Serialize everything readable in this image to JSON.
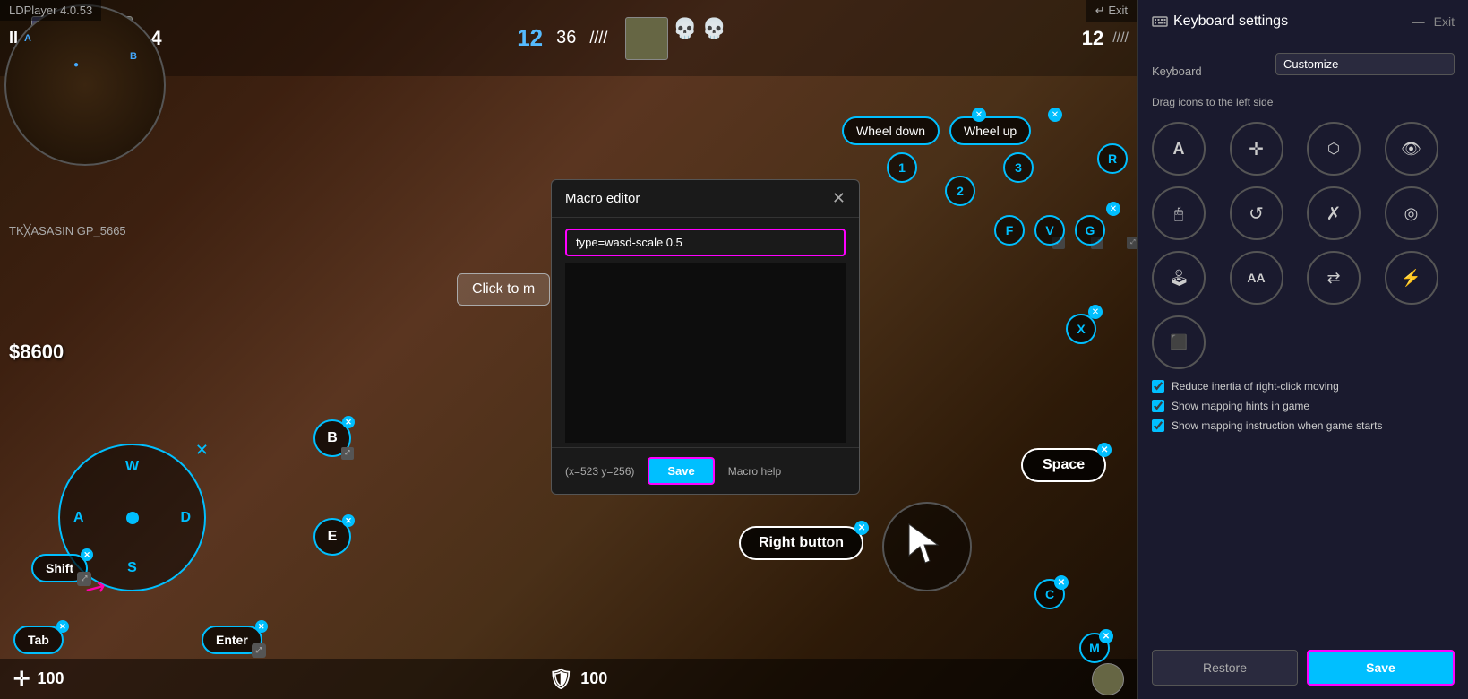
{
  "app": {
    "title": "LDPlayer 4.0.53",
    "exit_label": "Exit",
    "minimize_label": "—"
  },
  "panel": {
    "title": "Keyboard settings",
    "keyboard_label": "Keyboard",
    "keyboard_option": "Customize",
    "drag_hint": "Drag icons to the left side",
    "restore_label": "Restore",
    "save_label": "Save"
  },
  "checkboxes": [
    {
      "id": "cb1",
      "label": "Reduce inertia of right-click moving",
      "checked": true
    },
    {
      "id": "cb2",
      "label": "Show mapping hints in game",
      "checked": true
    },
    {
      "id": "cb3",
      "label": "Show mapping instruction when game starts",
      "checked": true
    }
  ],
  "hud": {
    "pause": "II",
    "left_score": "4",
    "right_score": "12",
    "time": "36",
    "ammo_main": "100",
    "ammo_reserve": "100",
    "money": "$8600",
    "player_name": "TK╳ASASIN       GP_5665"
  },
  "wasd": {
    "w": "W",
    "a": "A",
    "s": "S",
    "d": "D"
  },
  "buttons": {
    "shift": "Shift",
    "tab": "Tab",
    "enter": "Enter",
    "b": "B",
    "e": "E",
    "f": "F",
    "v": "V",
    "g": "G",
    "r": "R",
    "x": "X",
    "c": "C",
    "m": "M",
    "space": "Space",
    "right_button": "Right button",
    "wheel_down": "Wheel down",
    "wheel_up": "Wheel up",
    "num1": "1",
    "num2": "2",
    "num3": "3"
  },
  "macro": {
    "title": "Macro editor",
    "input_value": "type=wasd-scale 0.5",
    "textarea_value": "",
    "coords": "(x=523  y=256)",
    "save_label": "Save",
    "help_label": "Macro help"
  },
  "click_to": "Click to m",
  "icons": [
    {
      "name": "A-icon",
      "symbol": "A"
    },
    {
      "name": "crosshair-icon",
      "symbol": "✛"
    },
    {
      "name": "bullet-icon",
      "symbol": "⬡"
    },
    {
      "name": "eye-icon",
      "symbol": "👁"
    },
    {
      "name": "scroll-icon",
      "symbol": "🖱"
    },
    {
      "name": "refresh-icon",
      "symbol": "↺"
    },
    {
      "name": "cross-icon",
      "symbol": "✗"
    },
    {
      "name": "target-icon",
      "symbol": "◎"
    },
    {
      "name": "lb-icon",
      "symbol": "🕹"
    },
    {
      "name": "aa-icon",
      "symbol": "AA"
    },
    {
      "name": "switch-icon",
      "symbol": "⇄"
    },
    {
      "name": "bolt-icon",
      "symbol": "⚡"
    },
    {
      "name": "screen-icon",
      "symbol": "⬛"
    }
  ]
}
